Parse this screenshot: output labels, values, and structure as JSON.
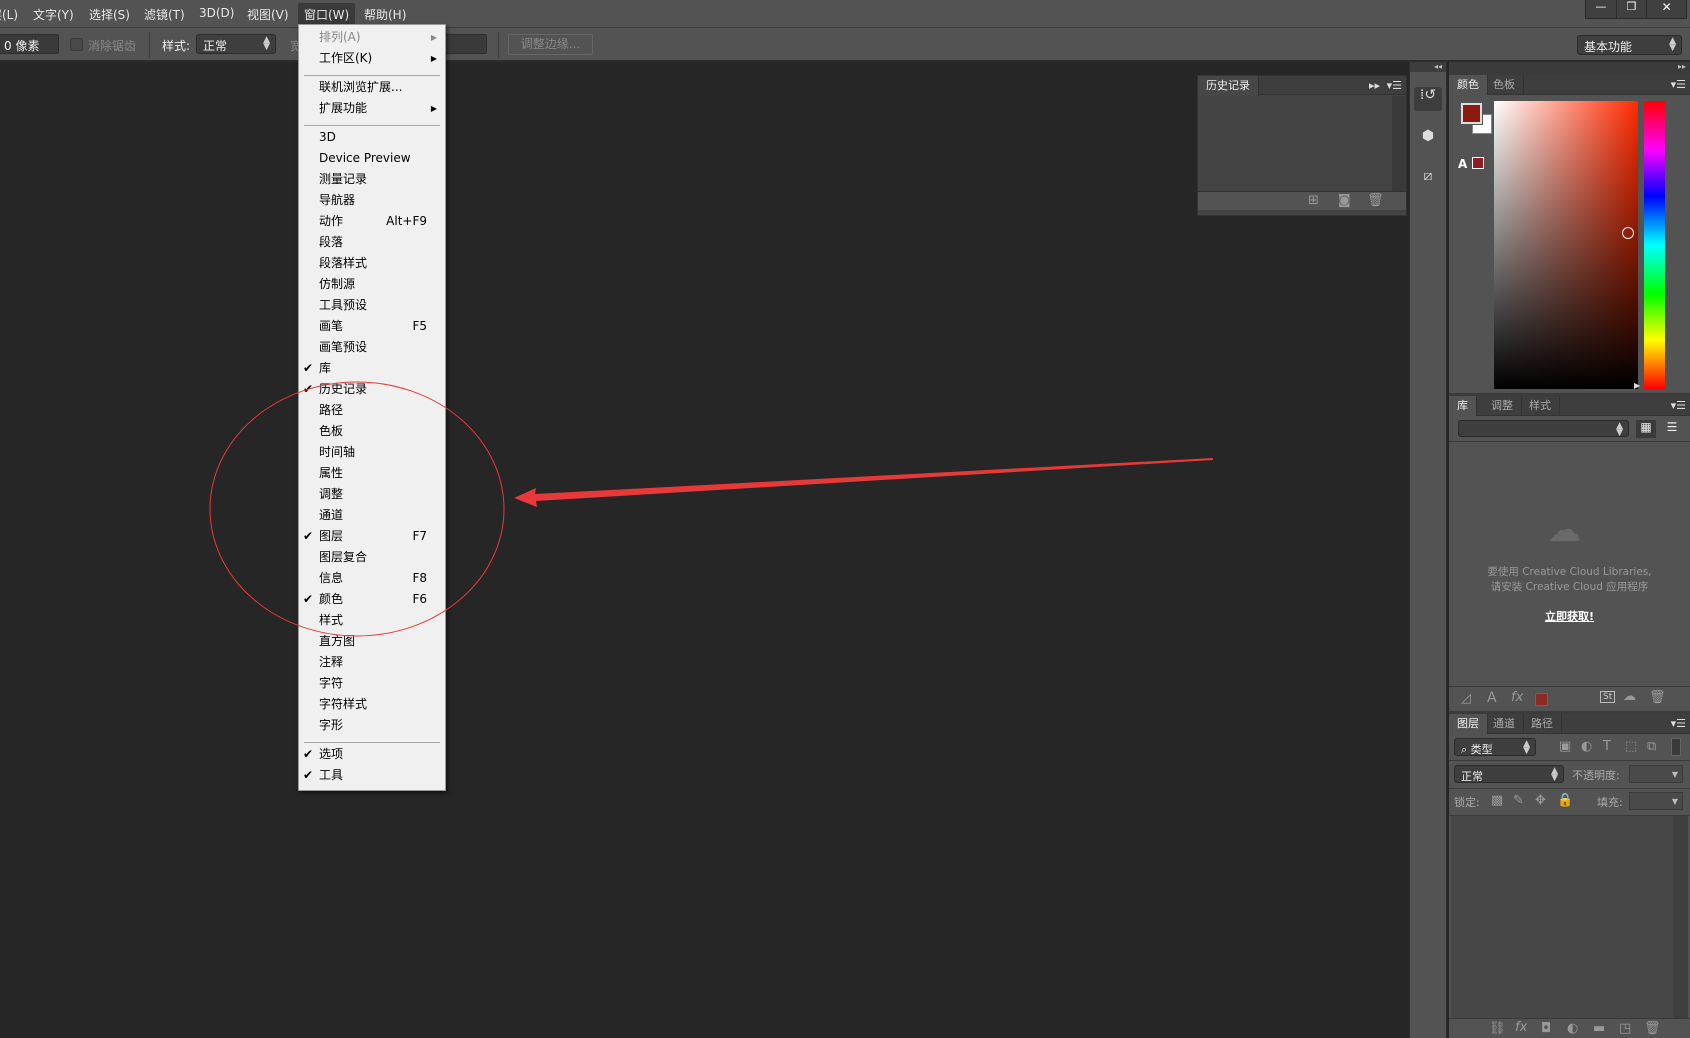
{
  "menubar": {
    "items": [
      "图层(L)",
      "文字(Y)",
      "选择(S)",
      "滤镜(T)",
      "3D(D)",
      "视图(V)",
      "窗口(W)",
      "帮助(H)"
    ]
  },
  "window_controls": {
    "minimize": "—",
    "restore": "❐",
    "close": "✕"
  },
  "options": {
    "feather_value": "0 像素",
    "antialias_label": "消除锯齿",
    "style_label": "样式:",
    "style_value": "正常",
    "width_label": "宽",
    "refine_edge": "调整边缘...",
    "workspace": "基本功能"
  },
  "menu": {
    "items": [
      {
        "label": "排列(A)",
        "submenu": true,
        "disabled": true
      },
      {
        "label": "工作区(K)",
        "submenu": true
      },
      {
        "sep": true
      },
      {
        "label": "联机浏览扩展..."
      },
      {
        "label": "扩展功能",
        "submenu": true
      },
      {
        "sep": true
      },
      {
        "label": "3D"
      },
      {
        "label": "Device Preview"
      },
      {
        "label": "测量记录"
      },
      {
        "label": "导航器"
      },
      {
        "label": "动作",
        "shortcut": "Alt+F9"
      },
      {
        "label": "段落"
      },
      {
        "label": "段落样式"
      },
      {
        "label": "仿制源"
      },
      {
        "label": "工具预设"
      },
      {
        "label": "画笔",
        "shortcut": "F5"
      },
      {
        "label": "画笔预设"
      },
      {
        "label": "库",
        "checked": true
      },
      {
        "label": "历史记录",
        "checked": true
      },
      {
        "label": "路径"
      },
      {
        "label": "色板"
      },
      {
        "label": "时间轴"
      },
      {
        "label": "属性"
      },
      {
        "label": "调整"
      },
      {
        "label": "通道"
      },
      {
        "label": "图层",
        "shortcut": "F7",
        "checked": true
      },
      {
        "label": "图层复合"
      },
      {
        "label": "信息",
        "shortcut": "F8"
      },
      {
        "label": "颜色",
        "shortcut": "F6",
        "checked": true
      },
      {
        "label": "样式"
      },
      {
        "label": "直方图"
      },
      {
        "label": "注释"
      },
      {
        "label": "字符"
      },
      {
        "label": "字符样式"
      },
      {
        "label": "字形"
      },
      {
        "sep": true
      },
      {
        "label": "选项",
        "checked": true
      },
      {
        "label": "工具",
        "checked": true
      }
    ]
  },
  "history_panel": {
    "tab": "历史记录"
  },
  "color_panel": {
    "tabs": [
      "颜色",
      "色板"
    ],
    "foreground": "#8b1a10",
    "background": "#ffffff",
    "hue_color": "#ff2a00"
  },
  "library_panel": {
    "tabs": [
      "库",
      "调整",
      "样式"
    ],
    "message_line1": "要使用 Creative Cloud Libraries,",
    "message_line2": "请安装 Creative Cloud 应用程序",
    "get_link": "立即获取!"
  },
  "layers_panel": {
    "tabs": [
      "图层",
      "通道",
      "路径"
    ],
    "filter_kind": "类型",
    "blend_mode": "正常",
    "opacity_label": "不透明度:",
    "lock_label": "锁定:",
    "fill_label": "填充:"
  },
  "annotation": {
    "color": "#e8393a"
  }
}
